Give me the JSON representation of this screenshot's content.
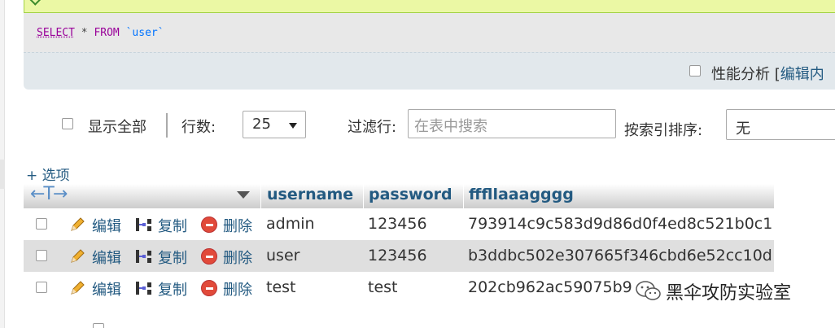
{
  "sql": {
    "kw_select": "SELECT",
    "star": "*",
    "kw_from": "FROM",
    "table": "`user`"
  },
  "tools": {
    "profiling_label": "性能分析 [",
    "edit_inline": "编辑内"
  },
  "nav": {
    "show_all": "显示全部",
    "rows_label": "行数:",
    "rows_value": "25",
    "filter_label": "过滤行:",
    "filter_placeholder": "在表中搜索",
    "sort_label": "按索引排序:",
    "sort_value": "无"
  },
  "options_link": "+ 选项",
  "table": {
    "columns": [
      "username",
      "password",
      "fffllaaagggg"
    ],
    "actions": {
      "edit": "编辑",
      "copy": "复制",
      "delete": "删除"
    },
    "rows": [
      {
        "username": "admin",
        "password": "123456",
        "flag": "793914c9c583d9d86d0f4ed8c521b0c1"
      },
      {
        "username": "user",
        "password": "123456",
        "flag": "b3ddbc502e307665f346cbd6e52cc10d"
      },
      {
        "username": "test",
        "password": "test",
        "flag": "202cb962ac59075b9"
      }
    ]
  },
  "watermark": "黑伞攻防实验室",
  "colors": {
    "link": "#235a81",
    "success_bg": "#ebf8a4",
    "sql_keyword": "#990099",
    "delete_red": "#e14a3a"
  },
  "icons": [
    "check-icon",
    "pencil-icon",
    "copy-icon",
    "delete-icon",
    "column-arrows-icon",
    "sort-triangle-icon",
    "dropdown-arrow-icon",
    "wechat-icon"
  ]
}
